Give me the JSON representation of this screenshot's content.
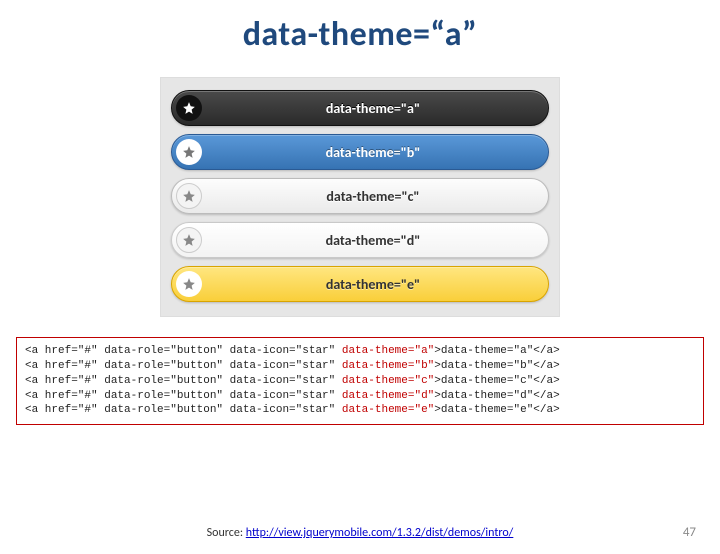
{
  "title": "data-theme=“a”",
  "buttons": [
    {
      "label": "data-theme=\"a\"",
      "themeClass": "theme-a"
    },
    {
      "label": "data-theme=\"b\"",
      "themeClass": "theme-b"
    },
    {
      "label": "data-theme=\"c\"",
      "themeClass": "theme-c"
    },
    {
      "label": "data-theme=\"d\"",
      "themeClass": "theme-d"
    },
    {
      "label": "data-theme=\"e\"",
      "themeClass": "theme-e"
    }
  ],
  "code": {
    "lines": [
      {
        "prefix": "<a href=\"#\" data-role=\"button\" data-icon=\"star\" ",
        "hl": "data-theme=\"a\"",
        "suffix": ">data-theme=\"a\"</a>"
      },
      {
        "prefix": "<a href=\"#\" data-role=\"button\" data-icon=\"star\" ",
        "hl": "data-theme=\"b\"",
        "suffix": ">data-theme=\"b\"</a>"
      },
      {
        "prefix": "<a href=\"#\" data-role=\"button\" data-icon=\"star\" ",
        "hl": "data-theme=\"c\"",
        "suffix": ">data-theme=\"c\"</a>"
      },
      {
        "prefix": "<a href=\"#\" data-role=\"button\" data-icon=\"star\" ",
        "hl": "data-theme=\"d\"",
        "suffix": ">data-theme=\"d\"</a>"
      },
      {
        "prefix": "<a href=\"#\" data-role=\"button\" data-icon=\"star\" ",
        "hl": "data-theme=\"e\"",
        "suffix": ">data-theme=\"e\"</a>"
      }
    ]
  },
  "source": {
    "prefix": "Source: ",
    "link_text": "http://view.jquerymobile.com/1.3.2/dist/demos/intro/"
  },
  "page_number": "47"
}
